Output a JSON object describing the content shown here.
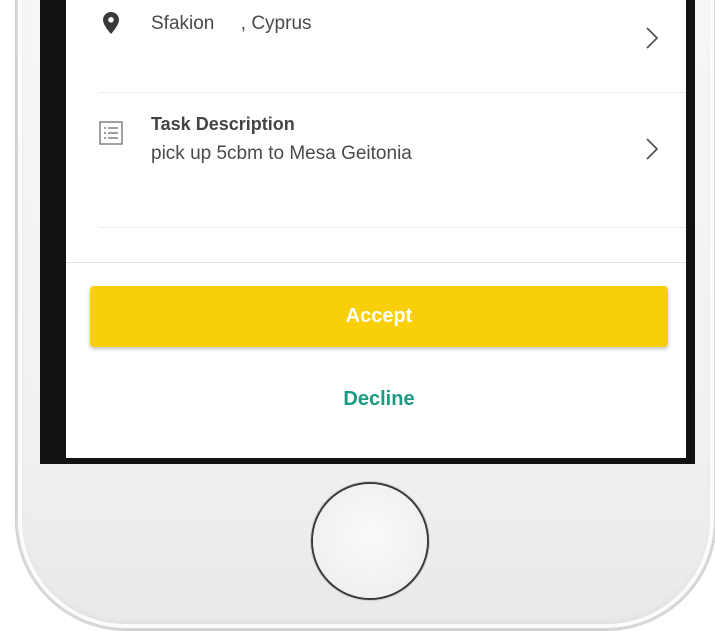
{
  "task": {
    "location_text": "Sfakion     , Cyprus",
    "description_title": "Task Description",
    "description_body": "pick up 5cbm to Mesa Geitonia"
  },
  "actions": {
    "accept_label": "Accept",
    "decline_label": "Decline"
  },
  "colors": {
    "accept": "#f9cf0a",
    "decline_text": "#1b9a84"
  },
  "icons": [
    "location-pin-icon",
    "list-icon",
    "chevron-right-icon",
    "home-button"
  ]
}
